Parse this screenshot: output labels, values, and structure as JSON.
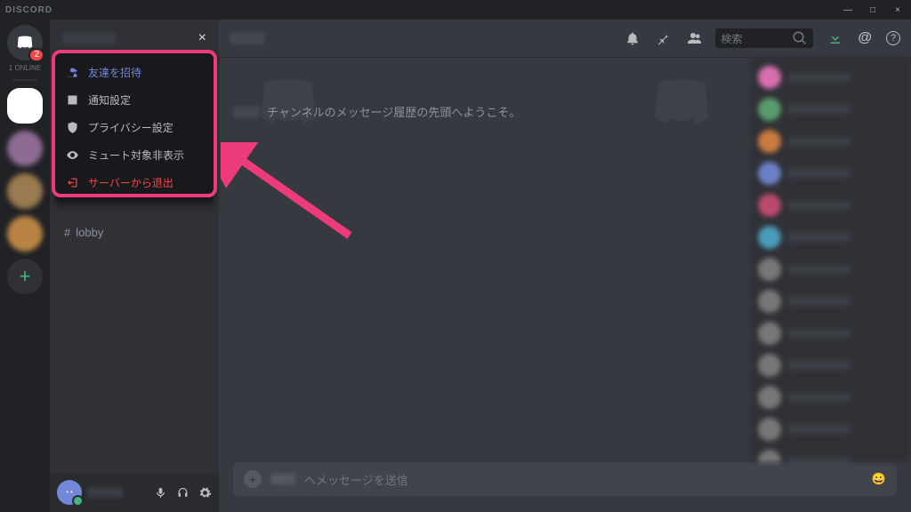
{
  "titlebar": {
    "brand": "DISCORD",
    "min": "—",
    "max": "□",
    "close": "×"
  },
  "guilds": {
    "badge": "2",
    "online": "1 ONLINE",
    "add": "+"
  },
  "server_header": {
    "close": "×"
  },
  "channel": {
    "hash": "#",
    "name": "lobby"
  },
  "dropdown": {
    "invite": "友達を招待",
    "notifications": "通知設定",
    "privacy": "プライバシー設定",
    "hide_muted": "ミュート対象非表示",
    "leave": "サーバーから退出"
  },
  "chat_header": {
    "search_placeholder": "検索",
    "at": "@",
    "help": "?"
  },
  "welcome": "チャンネルのメッセージ履歴の先頭へようこそ。",
  "composer": {
    "placeholder": "へメッセージを送信",
    "plus": "+",
    "emoji": "😀"
  }
}
